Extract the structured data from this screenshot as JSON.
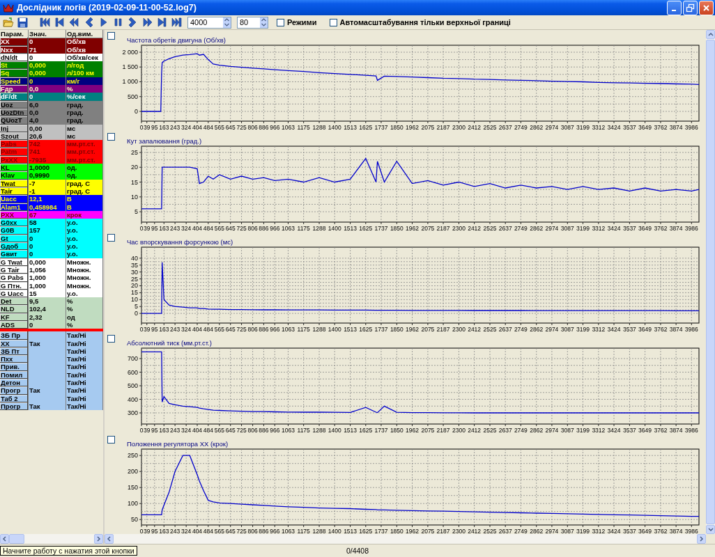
{
  "window": {
    "title": "Дослідник логів (2019-02-09-11-00-52.log7)"
  },
  "toolbar": {
    "field_1": "4000",
    "field_2": "80",
    "checkboxes": [
      {
        "label": "Режими",
        "checked": false
      },
      {
        "label": "Автомасштабування тільки верхньої границі",
        "checked": false
      }
    ]
  },
  "table": {
    "columns": [
      "Парам.",
      "Знач.",
      "Од.вим."
    ],
    "params": [
      {
        "name": "XX",
        "value": "0",
        "unit": "Об/хв",
        "color": "#800000"
      },
      {
        "name": "Nxx",
        "value": "71",
        "unit": "Об/хв",
        "color": "#800000"
      },
      {
        "name": "dN/dt",
        "value": "0",
        "unit": "Об/хв/сек",
        "color": "#ffffff"
      },
      {
        "name": "St",
        "value": "0,000",
        "unit": "л/год",
        "color": "#008000"
      },
      {
        "name": "Sq",
        "value": "0,000",
        "unit": "л/100 км",
        "color": "#008000"
      },
      {
        "name": "Speed",
        "value": "0",
        "unit": "км/г",
        "color": "#000080"
      },
      {
        "name": "Fдр",
        "value": "0,0",
        "unit": "%",
        "color": "#800080"
      },
      {
        "name": "dF/dt",
        "value": "0",
        "unit": "%/сек",
        "color": "#008080"
      },
      {
        "name": "Uoz",
        "value": "6,0",
        "unit": "град.",
        "color": "#808080"
      },
      {
        "name": "UozDtn",
        "value": "0,0",
        "unit": "град.",
        "color": "#808080"
      },
      {
        "name": "QUozT",
        "value": "4,0",
        "unit": "град.",
        "color": "#808080"
      },
      {
        "name": "Inj",
        "value": "0,00",
        "unit": "мс",
        "color": "#c0c0c0"
      },
      {
        "name": "Szout",
        "value": "20,6",
        "unit": "мс",
        "color": "#c0c0c0"
      },
      {
        "name": "Pabs",
        "value": "742",
        "unit": "мм.рт.ст.",
        "color": "#ff0000"
      },
      {
        "name": "Patm",
        "value": "741",
        "unit": "мм.рт.ст.",
        "color": "#ff0000"
      },
      {
        "name": "PxXX",
        "value": "-7935",
        "unit": "мм.рт.ст.",
        "color": "#ff0000"
      },
      {
        "name": "KL",
        "value": "1,0000",
        "unit": "од.",
        "color": "#00ff00"
      },
      {
        "name": "Klav",
        "value": "0,9990",
        "unit": "од.",
        "color": "#00ff00"
      },
      {
        "name": "Twat",
        "value": "-7",
        "unit": "град. С",
        "color": "#ffff00"
      },
      {
        "name": "Tair",
        "value": "-1",
        "unit": "град. С",
        "color": "#ffff00"
      },
      {
        "name": "Uacc",
        "value": "12,1",
        "unit": "В",
        "color": "#0000ff"
      },
      {
        "name": "Alam1",
        "value": "0,458984",
        "unit": "В",
        "color": "#0000ff"
      },
      {
        "name": "PXX",
        "value": "67",
        "unit": "крок",
        "color": "#ff00ff"
      },
      {
        "name": "G0xx",
        "value": "58",
        "unit": "у.о.",
        "color": "#00ffff"
      },
      {
        "name": "G0B",
        "value": "157",
        "unit": "у.о.",
        "color": "#00ffff"
      },
      {
        "name": "Gt",
        "value": "0",
        "unit": "у.о.",
        "color": "#00ffff"
      },
      {
        "name": "Gдоб",
        "value": "0",
        "unit": "у.о.",
        "color": "#00ffff"
      },
      {
        "name": "Gвит",
        "value": "0",
        "unit": "у.о.",
        "color": "#00ffff"
      },
      {
        "name": "G Twat",
        "value": "0,000",
        "unit": "Множн.",
        "color": "#ffffff"
      },
      {
        "name": "G Tair",
        "value": "1,056",
        "unit": "Множн.",
        "color": "#ffffff"
      },
      {
        "name": "G Pabs",
        "value": "1,000",
        "unit": "Множн.",
        "color": "#ffffff"
      },
      {
        "name": "G Птн.",
        "value": "1,000",
        "unit": "Множн.",
        "color": "#ffffff"
      },
      {
        "name": "G Uacc",
        "value": "15",
        "unit": "у.о.",
        "color": "#ffffff"
      },
      {
        "name": "Det",
        "value": "9,5",
        "unit": "%",
        "color": "#c0dcc0"
      },
      {
        "name": "NLD",
        "value": "102,4",
        "unit": "%",
        "color": "#c0dcc0"
      },
      {
        "name": "KF",
        "value": "2,32",
        "unit": "од",
        "color": "#c0dcc0"
      },
      {
        "name": "ADS",
        "value": "0",
        "unit": "%",
        "color": "#c0dcc0"
      }
    ],
    "flags": [
      {
        "name": "ЗБ Пр",
        "unit": "Так/Ні"
      },
      {
        "name": "XX",
        "value": "Так",
        "unit": "Так/Ні"
      },
      {
        "name": "ЗБ Пт",
        "unit": "Так/Ні"
      },
      {
        "name": "Пхх",
        "unit": "Так/Ні"
      },
      {
        "name": "Прив.",
        "unit": "Так/Ні"
      },
      {
        "name": "Помил",
        "unit": "Так/Ні"
      },
      {
        "name": "Детон",
        "unit": "Так/Ні"
      },
      {
        "name": "Прогр",
        "value": "Так",
        "unit": "Так/Ні"
      },
      {
        "name": "Таб 2",
        "unit": "Так/Ні"
      },
      {
        "name": "Прогр",
        "value": "Так",
        "unit": "Так/Ні"
      }
    ]
  },
  "charts": [
    {
      "checked": false,
      "chart_data": {
        "type": "line",
        "title": "Частота обретів двигуна (Об/хв)",
        "grid": true,
        "x": [
          0,
          140,
          146,
          150,
          163,
          200,
          243,
          300,
          350,
          404,
          420,
          450,
          484,
          520,
          565,
          645,
          725,
          806,
          886,
          966,
          1063,
          1175,
          1288,
          1400,
          1513,
          1625,
          1700,
          1710,
          1760,
          1850,
          1962,
          2075,
          2187,
          2300,
          2412,
          2525,
          2637,
          2749,
          2862,
          2974,
          3087,
          3199,
          3312,
          3424,
          3537,
          3649,
          3762,
          3874,
          3986,
          4040
        ],
        "series": [
          {
            "color": "#0000cc",
            "values": [
              0,
              0,
              1300,
              1650,
              1700,
              1780,
              1850,
              1900,
              1920,
              1950,
              1900,
              1930,
              1750,
              1600,
              1560,
              1520,
              1490,
              1460,
              1440,
              1410,
              1380,
              1350,
              1310,
              1280,
              1250,
              1220,
              1200,
              1050,
              1190,
              1180,
              1160,
              1140,
              1120,
              1110,
              1090,
              1080,
              1060,
              1050,
              1040,
              1020,
              1010,
              1000,
              980,
              970,
              960,
              950,
              940,
              930,
              920,
              910
            ]
          }
        ],
        "xlim": [
          0,
          4040
        ],
        "ylim": [
          -330,
          2235
        ],
        "xticks": [
          0,
          39,
          95,
          163,
          243,
          324,
          404,
          484,
          565,
          645,
          725,
          806,
          886,
          966,
          1063,
          1175,
          1288,
          1400,
          1513,
          1625,
          1737,
          1850,
          1962,
          2075,
          2187,
          2300,
          2412,
          2525,
          2637,
          2749,
          2862,
          2974,
          3087,
          3199,
          3312,
          3424,
          3537,
          3649,
          3762,
          3874,
          3986
        ],
        "yticks": [
          0,
          500,
          {
            "value": 1000,
            "label": "1 000"
          },
          {
            "value": 1500,
            "label": "1 500"
          },
          {
            "value": 2000,
            "label": "2 000"
          }
        ]
      }
    },
    {
      "checked": false,
      "chart_data": {
        "type": "line",
        "title": "Кут запалювання (град.)",
        "grid": true,
        "x": [
          0,
          140,
          146,
          150,
          163,
          200,
          243,
          300,
          350,
          404,
          420,
          450,
          484,
          520,
          565,
          645,
          725,
          806,
          886,
          966,
          1063,
          1175,
          1288,
          1400,
          1513,
          1625,
          1700,
          1710,
          1760,
          1850,
          1962,
          2075,
          2187,
          2300,
          2412,
          2525,
          2637,
          2749,
          2862,
          2974,
          3087,
          3199,
          3312,
          3424,
          3537,
          3649,
          3762,
          3874,
          3986,
          4040
        ],
        "series": [
          {
            "color": "#0000cc",
            "values": [
              6,
              6,
              6,
              20,
              20,
              20,
              20,
              20,
              20,
              19.5,
              14.5,
              15,
              17,
              16,
              17.5,
              16,
              17,
              16,
              16.5,
              15.5,
              16,
              15,
              16.5,
              15,
              16,
              23,
              15,
              22,
              15,
              22,
              14.5,
              15.5,
              14,
              15,
              13.5,
              14.5,
              13,
              14,
              13,
              13.5,
              12.5,
              13.5,
              12.5,
              13,
              12,
              13,
              12,
              12.5,
              12,
              12.5
            ]
          }
        ],
        "xlim": [
          0,
          4040
        ],
        "ylim": [
          1.5,
          27.1
        ],
        "xticks": [
          0,
          39,
          95,
          163,
          243,
          324,
          404,
          484,
          565,
          645,
          725,
          806,
          886,
          966,
          1063,
          1175,
          1288,
          1400,
          1513,
          1625,
          1737,
          1850,
          1962,
          2075,
          2187,
          2300,
          2412,
          2525,
          2637,
          2749,
          2862,
          2974,
          3087,
          3199,
          3312,
          3424,
          3537,
          3649,
          3762,
          3874,
          3986
        ],
        "yticks": [
          5,
          10,
          15,
          20,
          25
        ]
      }
    },
    {
      "checked": false,
      "chart_data": {
        "type": "line",
        "title": "Час впорскування форсункою (мс)",
        "grid": true,
        "x": [
          0,
          140,
          146,
          150,
          163,
          200,
          243,
          300,
          350,
          404,
          420,
          450,
          484,
          520,
          565,
          645,
          725,
          806,
          886,
          966,
          1063,
          1175,
          1288,
          1400,
          1513,
          1625,
          1700,
          1710,
          1760,
          1850,
          1962,
          2075,
          2187,
          2300,
          2412,
          2525,
          2637,
          2749,
          2862,
          2974,
          3087,
          3199,
          3312,
          3424,
          3537,
          3649,
          3762,
          3874,
          3986,
          4040
        ],
        "series": [
          {
            "color": "#0000cc",
            "values": [
              0,
              0,
              0,
              37,
              10,
              6,
              5,
              4.5,
              4,
              4,
              3.5,
              3.5,
              3.2,
              3,
              3,
              2.8,
              2.8,
              2.7,
              2.6,
              2.6,
              2.5,
              2.5,
              2.5,
              2.4,
              2.4,
              2.4,
              2.3,
              2.3,
              2.3,
              2.3,
              2.2,
              2.2,
              2.2,
              2.2,
              2.1,
              2.1,
              2.1,
              2.1,
              2,
              2,
              2,
              2,
              2,
              2,
              2,
              2,
              2,
              1.9,
              1.9,
              1.9
            ]
          }
        ],
        "xlim": [
          0,
          4040
        ],
        "ylim": [
          -7,
          48
        ],
        "xticks": [
          0,
          39,
          95,
          163,
          243,
          324,
          404,
          484,
          565,
          645,
          725,
          806,
          886,
          966,
          1063,
          1175,
          1288,
          1400,
          1513,
          1625,
          1737,
          1850,
          1962,
          2075,
          2187,
          2300,
          2412,
          2525,
          2637,
          2749,
          2862,
          2974,
          3087,
          3199,
          3312,
          3424,
          3537,
          3649,
          3762,
          3874,
          3986
        ],
        "yticks": [
          0,
          5,
          10,
          15,
          20,
          25,
          30,
          35,
          40
        ]
      }
    },
    {
      "checked": false,
      "chart_data": {
        "type": "line",
        "title": "Абсолютний тиск (мм.рт.ст.)",
        "grid": true,
        "x": [
          0,
          140,
          146,
          150,
          163,
          200,
          243,
          300,
          350,
          404,
          420,
          450,
          484,
          520,
          565,
          645,
          725,
          806,
          886,
          966,
          1063,
          1175,
          1288,
          1400,
          1513,
          1625,
          1700,
          1710,
          1760,
          1850,
          1962,
          2075,
          2187,
          2300,
          2412,
          2525,
          2637,
          2749,
          2862,
          2974,
          3087,
          3199,
          3312,
          3424,
          3537,
          3649,
          3762,
          3874,
          3986,
          4040
        ],
        "series": [
          {
            "color": "#0000cc",
            "values": [
              750,
              750,
              750,
              380,
              420,
              370,
              360,
              350,
              345,
              340,
              335,
              330,
              325,
              320,
              318,
              315,
              312,
              310,
              310,
              308,
              306,
              305,
              305,
              304,
              303,
              340,
              305,
              302,
              350,
              304,
              302,
              302,
              301,
              301,
              300,
              300,
              300,
              300,
              300,
              300,
              300,
              300,
              300,
              300,
              300,
              300,
              300,
              300,
              300,
              300
            ]
          }
        ],
        "xlim": [
          0,
          4040
        ],
        "ylim": [
          218,
          777
        ],
        "xticks": [
          0,
          39,
          95,
          163,
          243,
          324,
          404,
          484,
          565,
          645,
          725,
          806,
          886,
          966,
          1063,
          1175,
          1288,
          1400,
          1513,
          1625,
          1737,
          1850,
          1962,
          2075,
          2187,
          2300,
          2412,
          2525,
          2637,
          2749,
          2862,
          2974,
          3087,
          3199,
          3312,
          3424,
          3537,
          3649,
          3762,
          3874,
          3986
        ],
        "yticks": [
          300,
          400,
          500,
          600,
          700
        ]
      }
    },
    {
      "checked": false,
      "chart_data": {
        "type": "line",
        "title": "Положення регулятора ХХ (крок)",
        "grid": true,
        "x": [
          0,
          140,
          146,
          150,
          163,
          200,
          243,
          300,
          350,
          404,
          420,
          450,
          484,
          520,
          565,
          645,
          725,
          806,
          886,
          966,
          1063,
          1175,
          1288,
          1400,
          1513,
          1625,
          1700,
          1710,
          1760,
          1850,
          1962,
          2075,
          2187,
          2300,
          2412,
          2525,
          2637,
          2749,
          2862,
          2974,
          3087,
          3199,
          3312,
          3424,
          3537,
          3649,
          3762,
          3874,
          3986,
          4040
        ],
        "series": [
          {
            "color": "#0000cc",
            "values": [
              65,
              65,
              65,
              80,
              95,
              135,
              200,
              250,
              250,
              190,
              170,
              140,
              110,
              105,
              102,
              100,
              98,
              96,
              94,
              92,
              90,
              88,
              86,
              85,
              84,
              82,
              81,
              80,
              80,
              79,
              78,
              77,
              76,
              75,
              74,
              73,
              72,
              71,
              70,
              69,
              68,
              67,
              66,
              65,
              64,
              63,
              62,
              61,
              60,
              60
            ]
          }
        ],
        "xlim": [
          0,
          4040
        ],
        "ylim": [
          33,
          270
        ],
        "xticks": [
          0,
          39,
          95,
          163,
          243,
          324,
          404,
          484,
          565,
          645,
          725,
          806,
          886,
          966,
          1063,
          1175,
          1288,
          1400,
          1513,
          1625,
          1737,
          1850,
          1962,
          2075,
          2187,
          2300,
          2412,
          2525,
          2637,
          2749,
          2862,
          2974,
          3087,
          3199,
          3312,
          3424,
          3537,
          3649,
          3762,
          3874,
          3986
        ],
        "yticks": [
          50,
          100,
          150,
          200,
          250
        ]
      }
    }
  ],
  "status_bar": {
    "tooltip": "Начните работу с нажатия этой кнопки",
    "position": "0/4408"
  }
}
